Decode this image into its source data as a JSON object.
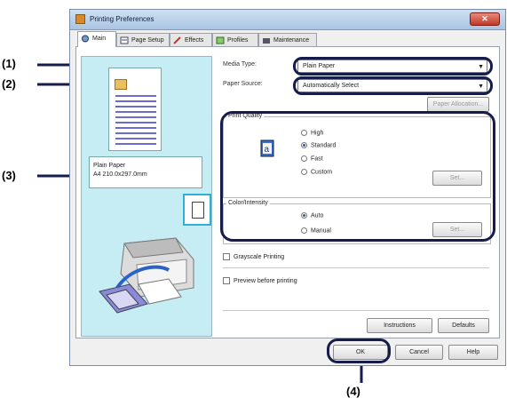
{
  "window": {
    "title": "Printing Preferences",
    "close_glyph": "✕"
  },
  "tabs": [
    {
      "label": "Main",
      "icon": "main-icon",
      "active": true
    },
    {
      "label": "Page Setup",
      "icon": "page-setup-icon",
      "active": false
    },
    {
      "label": "Effects",
      "icon": "effects-icon",
      "active": false
    },
    {
      "label": "Profiles",
      "icon": "profiles-icon",
      "active": false
    },
    {
      "label": "Maintenance",
      "icon": "maintenance-icon",
      "active": false
    }
  ],
  "preview": {
    "paper_name": "Plain Paper",
    "paper_size": "A4 210.0x297.0mm"
  },
  "media_type": {
    "label": "Media Type:",
    "value": "Plain Paper"
  },
  "paper_source": {
    "label": "Paper Source:",
    "value": "Automatically Select"
  },
  "paper_allocation_button": "Paper Allocation...",
  "print_quality": {
    "caption": "Print Quality",
    "options": [
      "High",
      "Standard",
      "Fast",
      "Custom"
    ],
    "selected": "Standard",
    "set_button": "Set..."
  },
  "color_intensity": {
    "caption": "Color/Intensity",
    "options": [
      "Auto",
      "Manual"
    ],
    "selected": "Auto",
    "set_button": "Set..."
  },
  "grayscale_printing": "Grayscale Printing",
  "preview_before_printing": "Preview before printing",
  "instructions_button": "Instructions",
  "defaults_button": "Defaults",
  "ok_button": "OK",
  "cancel_button": "Cancel",
  "help_button": "Help",
  "callouts": [
    "(1)",
    "(2)",
    "(3)",
    "(4)"
  ],
  "colors": {
    "callout": "#161d4a",
    "preview_bg": "#c6ecf4",
    "titlebar": "#a9c4e3"
  }
}
